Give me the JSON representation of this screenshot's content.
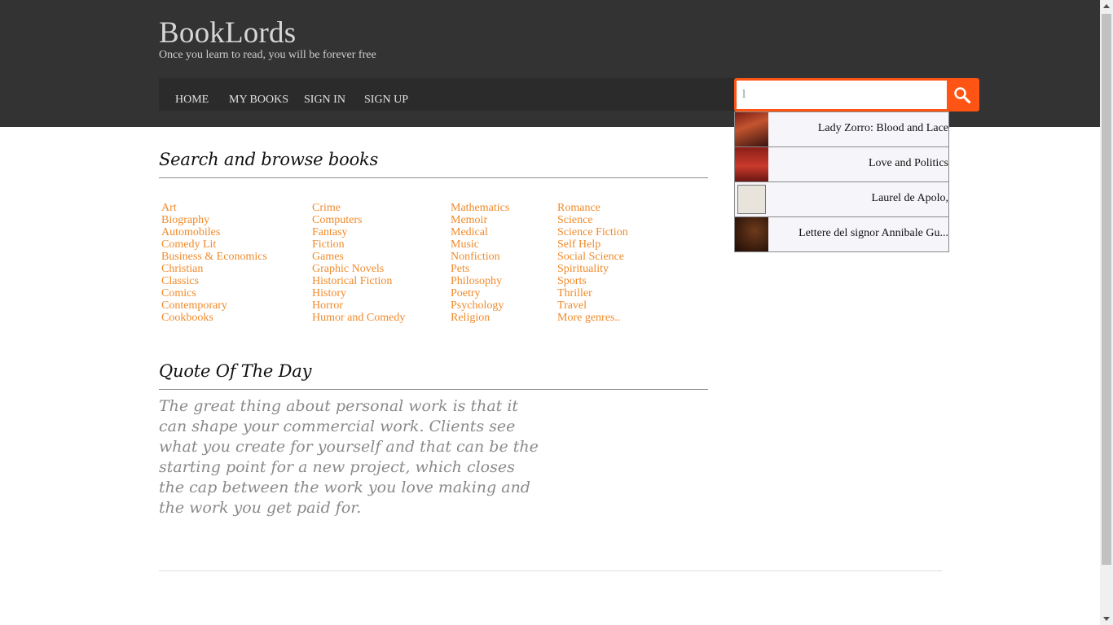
{
  "header": {
    "site_title": "BookLords",
    "tagline": "Once you learn to read, you will be forever free"
  },
  "nav": [
    "HOME",
    "MY BOOKS",
    "SIGN IN",
    "SIGN UP"
  ],
  "search": {
    "value": "l",
    "button_icon": "search-icon",
    "accent_color": "#ff5413",
    "suggestions": [
      {
        "title": "Lady Zorro: Blood and Lace"
      },
      {
        "title": "Love and Politics"
      },
      {
        "title": "Laurel de Apolo,"
      },
      {
        "title": "Lettere del signor Annibale Gu..."
      }
    ]
  },
  "browse": {
    "heading": "Search and browse books",
    "genre_color": "#f08a2a",
    "columns": [
      [
        "Art",
        "Biography",
        "Automobiles",
        "Comedy Lit",
        "Business & Economics",
        "Christian",
        "Classics",
        "Comics",
        "Contemporary",
        "Cookbooks"
      ],
      [
        "Crime",
        "Computers",
        "Fantasy",
        "Fiction",
        "Games",
        "Graphic Novels",
        "Historical Fiction",
        "History",
        "Horror",
        "Humor and Comedy"
      ],
      [
        "Mathematics",
        "Memoir",
        "Medical",
        "Music",
        "Nonfiction",
        "Pets",
        "Philosophy",
        "Poetry",
        "Psychology",
        "Religion"
      ],
      [
        "Romance",
        "Science",
        "Science Fiction",
        "Self Help",
        "Social Science",
        "Spirituality",
        "Sports",
        "Thriller",
        "Travel",
        "More genres.."
      ]
    ]
  },
  "quote": {
    "heading": "Quote Of The Day",
    "text": "The great thing about personal work is that it can shape your commercial work. Clients see what you create for yourself and that can be the starting point for a new project, which closes the cap between the work you love making and the work you get paid for."
  }
}
